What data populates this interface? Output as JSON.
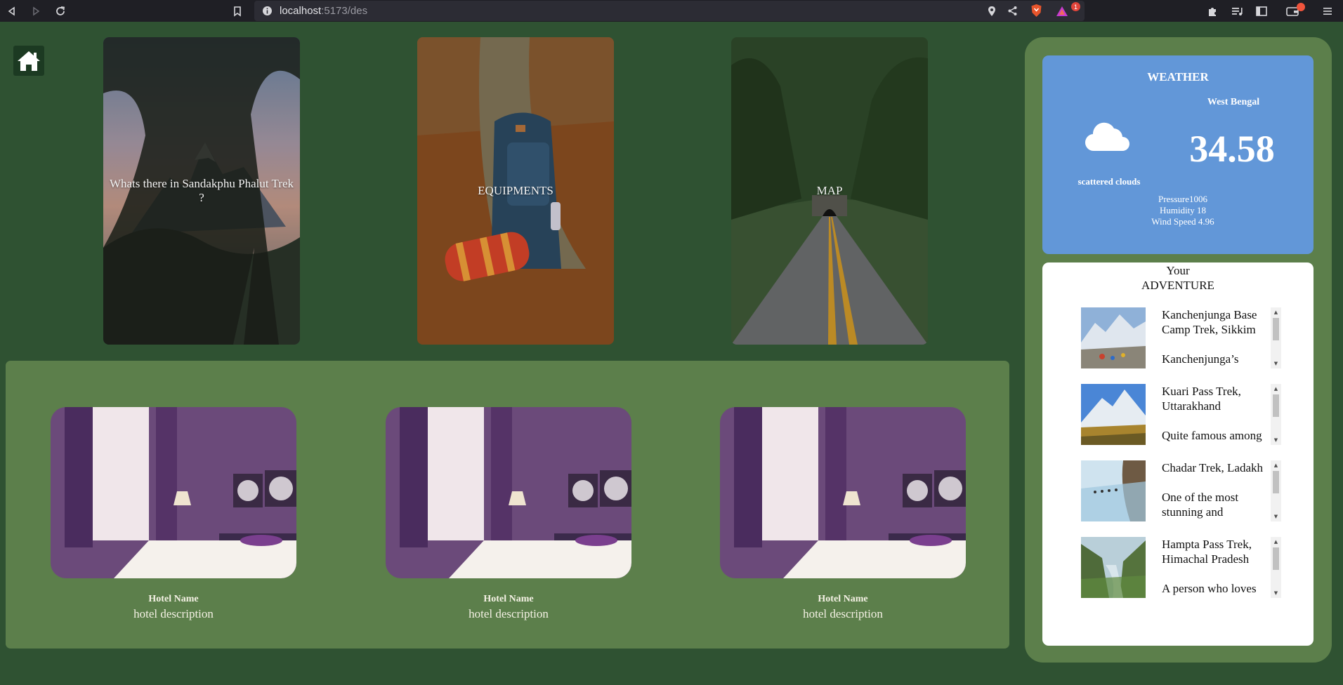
{
  "browser": {
    "url_host": "localhost",
    "url_path": ":5173/des",
    "notification_count": "1"
  },
  "cards": [
    {
      "label": "Whats there in Sandakphu Phalut Trek ?"
    },
    {
      "label": "EQUIPMENTS"
    },
    {
      "label": "MAP"
    }
  ],
  "hotels": [
    {
      "name": "Hotel Name",
      "description": "hotel description"
    },
    {
      "name": "Hotel Name",
      "description": "hotel description"
    },
    {
      "name": "Hotel Name",
      "description": "hotel description"
    }
  ],
  "weather": {
    "title": "WEATHER",
    "region": "West Bengal",
    "temperature": "34.58",
    "condition": "scattered clouds",
    "pressure": "Pressure1006",
    "humidity": "Humidity 18",
    "wind": "Wind Speed 4.96",
    "icon": "cloud-icon"
  },
  "adventure": {
    "heading_line1": "Your",
    "heading_line2": "ADVENTURE",
    "items": [
      {
        "title": "Kanchenjunga Base Camp Trek, Sikkim",
        "desc": "Kanchenjunga’s"
      },
      {
        "title": "Kuari Pass Trek, Uttarakhand",
        "desc": "Quite famous among"
      },
      {
        "title": "Chadar Trek, Ladakh",
        "desc": "One of the most stunning and"
      },
      {
        "title": "Hampta Pass Trek, Himachal Pradesh",
        "desc": "A person who loves"
      }
    ]
  },
  "colors": {
    "page_bg": "#2f5232",
    "panel_green": "#5c7f4b",
    "weather_blue": "#6297d8"
  }
}
